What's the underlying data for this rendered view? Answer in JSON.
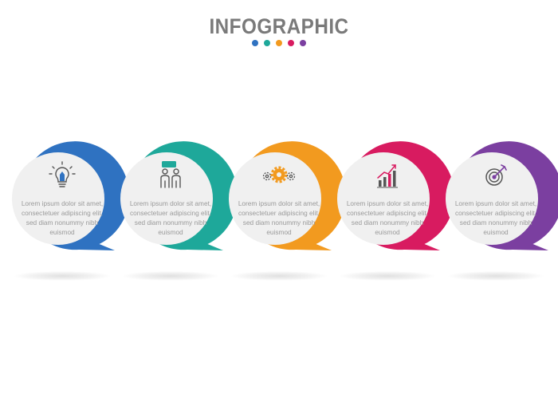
{
  "title": "INFOGRAPHIC",
  "dots": [
    "#2f72c1",
    "#1ea89a",
    "#f29a1f",
    "#d81b60",
    "#7b3fa0"
  ],
  "steps": [
    {
      "color": "#2f72c1",
      "icon": "lightbulb-icon",
      "text": "Lorem ipsum dolor sit amet, consectetuer adipiscing elit, sed diam nonummy nibh euismod"
    },
    {
      "color": "#1ea89a",
      "icon": "people-chat-icon",
      "text": "Lorem ipsum dolor sit amet, consectetuer adipiscing elit, sed diam nonummy nibh euismod"
    },
    {
      "color": "#f29a1f",
      "icon": "gears-icon",
      "text": "Lorem ipsum dolor sit amet, consectetuer adipiscing elit, sed diam nonummy nibh euismod"
    },
    {
      "color": "#d81b60",
      "icon": "growth-chart-icon",
      "text": "Lorem ipsum dolor sit amet, consectetuer adipiscing elit, sed diam nonummy nibh euismod"
    },
    {
      "color": "#7b3fa0",
      "icon": "target-arrow-icon",
      "text": "Lorem ipsum dolor sit amet, consectetuer adipiscing elit, sed diam nonummy nibh euismod"
    }
  ]
}
